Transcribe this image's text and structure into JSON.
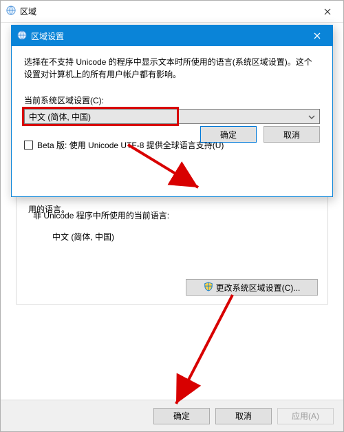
{
  "outer": {
    "title": "区域",
    "remnant_text": "用的语言。",
    "group": {
      "line1": "非 Unicode 程序中所使用的当前语言:",
      "line2": "中文 (简体, 中国)",
      "change_btn": "更改系统区域设置(C)..."
    },
    "footer": {
      "ok": "确定",
      "cancel": "取消",
      "apply": "应用(A)"
    }
  },
  "dialog": {
    "title": "区域设置",
    "description": "选择在不支持 Unicode 的程序中显示文本时所使用的语言(系统区域设置)。这个设置对计算机上的所有用户帐户都有影响。",
    "combo_label": "当前系统区域设置(C):",
    "combo_value": "中文 (简体, 中国)",
    "checkbox_label": "Beta 版: 使用 Unicode UTF-8 提供全球语言支持(U)",
    "ok": "确定",
    "cancel": "取消"
  },
  "colors": {
    "accent": "#0a84d8",
    "highlight": "#d80000"
  }
}
